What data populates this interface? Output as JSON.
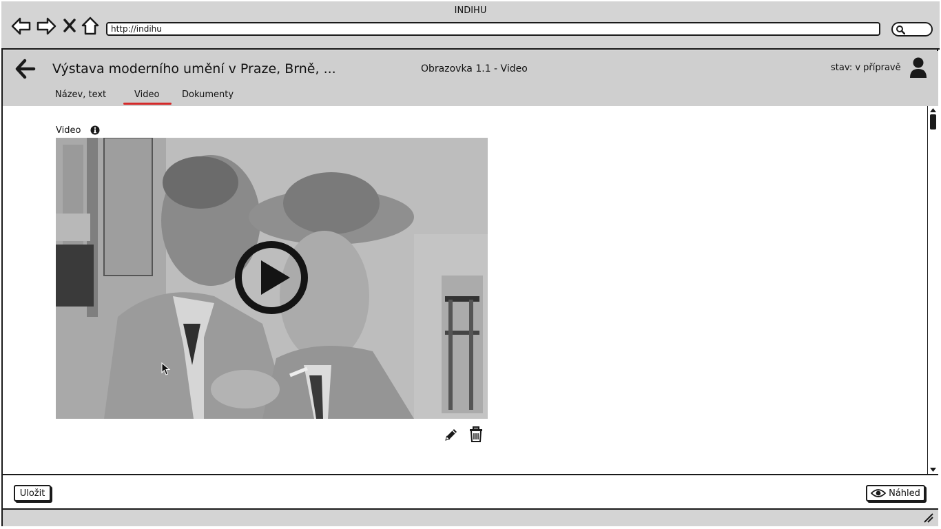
{
  "browser": {
    "window_title": "INDIHU",
    "url": "http://indihu",
    "icons": [
      "back-arrow-icon",
      "forward-arrow-icon",
      "close-icon",
      "home-icon",
      "search-icon"
    ]
  },
  "header": {
    "exhibition_title": "Výstava moderního umění v Praze, Brně, ...",
    "screen_title": "Obrazovka 1.1 - Video",
    "status": "stav: v přípravě",
    "tabs": [
      {
        "label": "Název, text",
        "active": false
      },
      {
        "label": "Video",
        "active": true
      },
      {
        "label": "Dokumenty",
        "active": false
      }
    ],
    "accent_color": "#d42a2a"
  },
  "content": {
    "video_label": "Video",
    "video": {
      "state": "paused",
      "has_play_button": true
    },
    "actions": [
      "edit-icon",
      "delete-icon"
    ]
  },
  "footer": {
    "save_label": "Uložit",
    "preview_label": "Náhled"
  }
}
